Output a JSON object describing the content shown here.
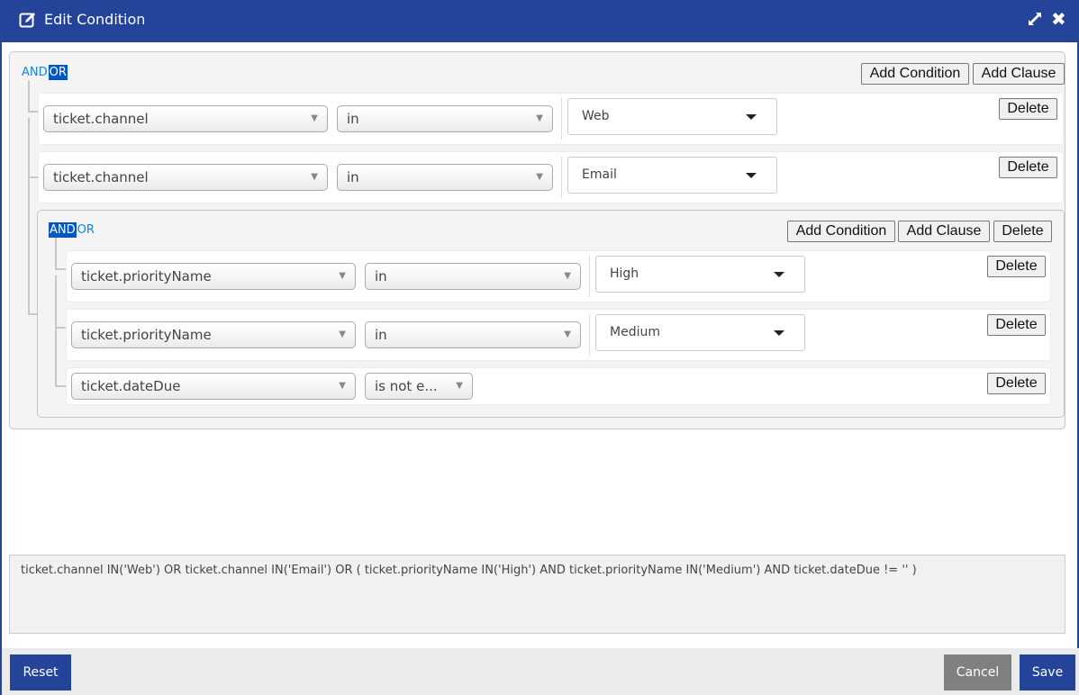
{
  "dialog": {
    "title": "Edit Condition",
    "icons": {
      "title": "edit-icon",
      "expand": "expand-icon",
      "close": "close-icon"
    }
  },
  "root_group": {
    "operators": {
      "and": "AND",
      "or": "OR",
      "selected": "OR"
    },
    "add_condition_label": "Add Condition",
    "add_clause_label": "Add Clause",
    "rules": [
      {
        "field": "ticket.channel",
        "operator": "in",
        "value": "Web",
        "delete_label": "Delete"
      },
      {
        "field": "ticket.channel",
        "operator": "in",
        "value": "Email",
        "delete_label": "Delete"
      }
    ],
    "sub_group": {
      "operators": {
        "and": "AND",
        "or": "OR",
        "selected": "AND"
      },
      "add_condition_label": "Add Condition",
      "add_clause_label": "Add Clause",
      "delete_label": "Delete",
      "rules": [
        {
          "field": "ticket.priorityName",
          "operator": "in",
          "value": "High",
          "delete_label": "Delete"
        },
        {
          "field": "ticket.priorityName",
          "operator": "in",
          "value": "Medium",
          "delete_label": "Delete"
        },
        {
          "field": "ticket.dateDue",
          "operator": "is not e...",
          "delete_label": "Delete"
        }
      ]
    }
  },
  "sql_preview": "ticket.channel IN('Web') OR ticket.channel IN('Email') OR ( ticket.priorityName IN('High') AND ticket.priorityName IN('Medium') AND ticket.dateDue != '' )",
  "footer": {
    "reset_label": "Reset",
    "cancel_label": "Cancel",
    "save_label": "Save"
  },
  "colors": {
    "brand": "#24449a",
    "selected_operator": "#0057c2",
    "link": "#1a82e2",
    "cancel": "#808080"
  }
}
